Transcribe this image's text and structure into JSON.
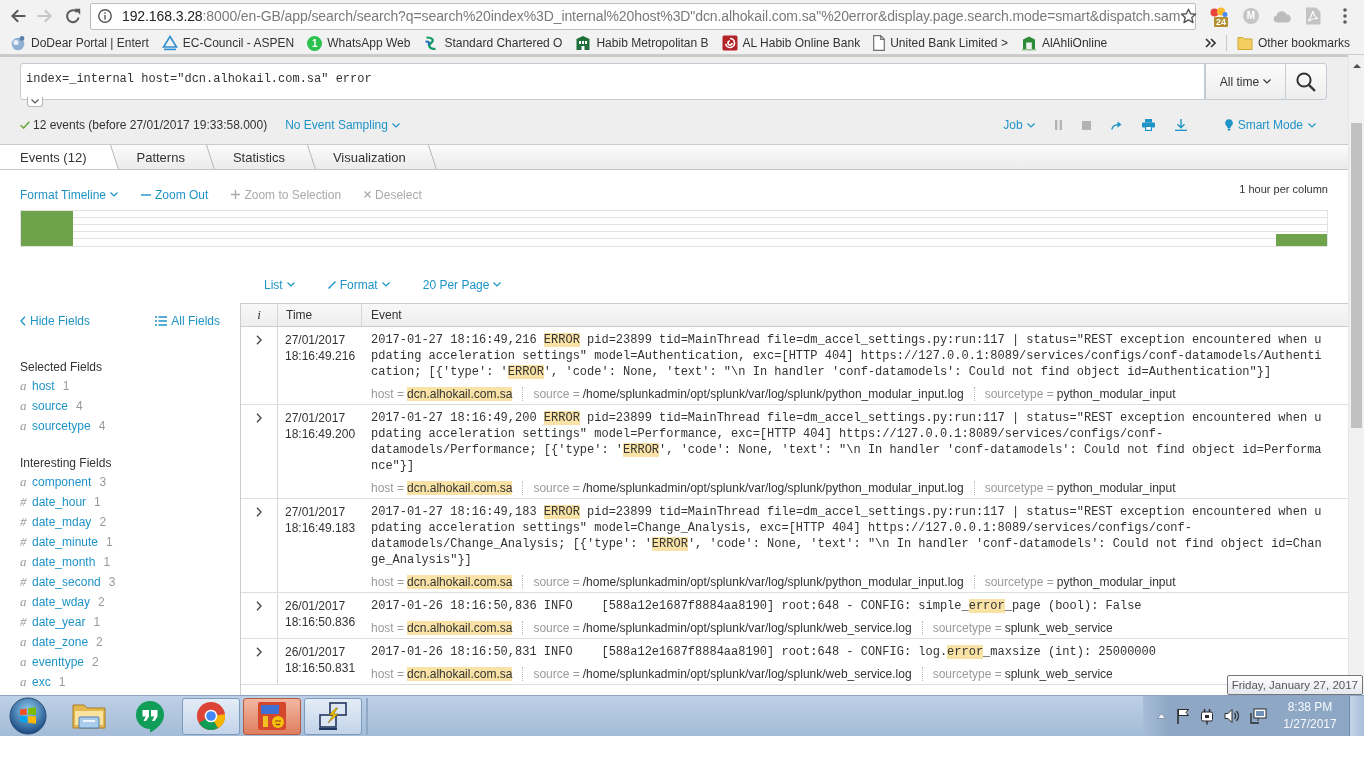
{
  "browser": {
    "url_host": "192.168.3.28",
    "url_rest": ":8000/en-GB/app/search/search?q=search%20index%3D_internal%20host%3D\"dcn.alhokail.com.sa\"%20error&display.page.search.mode=smart&dispatch.sam",
    "extensions": [
      {
        "kind": "dots",
        "badge": "24"
      },
      {
        "kind": "letter",
        "label": "M"
      },
      {
        "kind": "cloud"
      },
      {
        "kind": "pdf"
      }
    ],
    "bookmarks": [
      {
        "kind": "sphere",
        "label": "DoDear Portal | Entert"
      },
      {
        "kind": "triangle",
        "label": "EC-Council - ASPEN"
      },
      {
        "kind": "count",
        "badge": "1",
        "label": "WhatsApp Web"
      },
      {
        "kind": "stripes",
        "label": "Standard Chartered O"
      },
      {
        "kind": "building",
        "label": "Habib Metropolitan B"
      },
      {
        "kind": "tile",
        "label": "AL Habib Online Bank"
      },
      {
        "kind": "page",
        "label": "United Bank Limited >"
      },
      {
        "kind": "gate",
        "label": "AlAhliOnline"
      }
    ],
    "other_bookmarks": "Other bookmarks"
  },
  "search": {
    "query": "index=_internal host=\"dcn.alhokail.com.sa\" error",
    "expanded": false,
    "time_range": "All time"
  },
  "status": {
    "summary": "12 events (before 27/01/2017 19:33:58.000)",
    "sampling": "No Event Sampling",
    "job": "Job",
    "job_controls": [
      {
        "kind": "pause",
        "disabled": true
      },
      {
        "kind": "stop",
        "disabled": true
      },
      {
        "kind": "share",
        "disabled": false
      },
      {
        "kind": "print",
        "disabled": false
      },
      {
        "kind": "export",
        "disabled": false
      }
    ],
    "mode": "Smart Mode"
  },
  "tabs": [
    {
      "label": "Events (12)",
      "selected": true
    },
    {
      "label": "Patterns",
      "selected": false
    },
    {
      "label": "Statistics",
      "selected": false
    },
    {
      "label": "Visualization",
      "selected": false
    }
  ],
  "timeline": {
    "controls": [
      {
        "kind": "menu",
        "label": "Format Timeline",
        "disabled": false
      },
      {
        "kind": "zoom_out",
        "label": "Zoom Out",
        "disabled": false
      },
      {
        "kind": "zoom_in",
        "label": "Zoom to Selection",
        "disabled": true
      },
      {
        "kind": "deselect",
        "label": "Deselect",
        "disabled": true
      }
    ],
    "scale": "1 hour per column"
  },
  "results_toolbar": [
    {
      "kind": "list",
      "label": "List"
    },
    {
      "kind": "format",
      "label": "Format"
    },
    {
      "kind": "paging",
      "label": "20 Per Page"
    }
  ],
  "fields_sidebar": {
    "hide": "Hide Fields",
    "all": "All Fields",
    "groups": [
      {
        "title": "Selected Fields",
        "fields": [
          {
            "type": "a",
            "name": "host",
            "count": "1"
          },
          {
            "type": "a",
            "name": "source",
            "count": "4"
          },
          {
            "type": "a",
            "name": "sourcetype",
            "count": "4"
          }
        ]
      },
      {
        "title": "Interesting Fields",
        "fields": [
          {
            "type": "a",
            "name": "component",
            "count": "3"
          },
          {
            "type": "#",
            "name": "date_hour",
            "count": "1"
          },
          {
            "type": "#",
            "name": "date_mday",
            "count": "2"
          },
          {
            "type": "#",
            "name": "date_minute",
            "count": "1"
          },
          {
            "type": "a",
            "name": "date_month",
            "count": "1"
          },
          {
            "type": "#",
            "name": "date_second",
            "count": "3"
          },
          {
            "type": "a",
            "name": "date_wday",
            "count": "2"
          },
          {
            "type": "#",
            "name": "date_year",
            "count": "1"
          },
          {
            "type": "a",
            "name": "date_zone",
            "count": "2"
          },
          {
            "type": "a",
            "name": "eventtype",
            "count": "2"
          },
          {
            "type": "a",
            "name": "exc",
            "count": "1"
          }
        ]
      }
    ]
  },
  "events": {
    "columns": [
      "i",
      "Time",
      "Event"
    ],
    "rows": [
      {
        "time": "27/01/2017 18:16:49.216",
        "lines": [
          [
            {
              "text": "2017-01-27 18:16:49,216 ",
              "highlight": false
            },
            {
              "text": "ERROR",
              "highlight": true
            },
            {
              "text": " pid=23899 tid=MainThread file=dm_accel_settings.py:run:117 | status=\"REST exception encountered when u",
              "highlight": false
            }
          ],
          [
            {
              "text": "pdating acceleration settings\" model=Authentication, exc=[HTTP 404] https://127.0.0.1:8089/services/configs/conf-datamodels/Authenti",
              "highlight": false
            }
          ],
          [
            {
              "text": "cation; [{'type': '",
              "highlight": false
            },
            {
              "text": "ERROR",
              "highlight": true
            },
            {
              "text": "', 'code': None, 'text': \"\\n In handler 'conf-datamodels': Could not find object id=Authentication\"}]",
              "highlight": false
            }
          ]
        ],
        "fields": [
          {
            "label": "host =",
            "value": "dcn.alhokail.com.sa",
            "highlight": true
          },
          {
            "label": "source =",
            "value": "/home/splunkadmin/opt/splunk/var/log/splunk/python_modular_input.log",
            "highlight": false
          },
          {
            "label": "sourcetype =",
            "value": "python_modular_input",
            "highlight": false
          }
        ]
      },
      {
        "time": "27/01/2017 18:16:49.200",
        "lines": [
          [
            {
              "text": "2017-01-27 18:16:49,200 ",
              "highlight": false
            },
            {
              "text": "ERROR",
              "highlight": true
            },
            {
              "text": " pid=23899 tid=MainThread file=dm_accel_settings.py:run:117 | status=\"REST exception encountered when u",
              "highlight": false
            }
          ],
          [
            {
              "text": "pdating acceleration settings\" model=Performance, exc=[HTTP 404] https://127.0.0.1:8089/services/configs/conf-",
              "highlight": false
            }
          ],
          [
            {
              "text": "datamodels/Performance; [{'type': '",
              "highlight": false
            },
            {
              "text": "ERROR",
              "highlight": true
            },
            {
              "text": "', 'code': None, 'text': \"\\n In handler 'conf-datamodels': Could not find object id=Performa",
              "highlight": false
            }
          ],
          [
            {
              "text": "nce\"}]",
              "highlight": false
            }
          ]
        ],
        "fields": [
          {
            "label": "host =",
            "value": "dcn.alhokail.com.sa",
            "highlight": true
          },
          {
            "label": "source =",
            "value": "/home/splunkadmin/opt/splunk/var/log/splunk/python_modular_input.log",
            "highlight": false
          },
          {
            "label": "sourcetype =",
            "value": "python_modular_input",
            "highlight": false
          }
        ]
      },
      {
        "time": "27/01/2017 18:16:49.183",
        "lines": [
          [
            {
              "text": "2017-01-27 18:16:49,183 ",
              "highlight": false
            },
            {
              "text": "ERROR",
              "highlight": true
            },
            {
              "text": " pid=23899 tid=MainThread file=dm_accel_settings.py:run:117 | status=\"REST exception encountered when u",
              "highlight": false
            }
          ],
          [
            {
              "text": "pdating acceleration settings\" model=Change_Analysis, exc=[HTTP 404] https://127.0.0.1:8089/services/configs/conf-",
              "highlight": false
            }
          ],
          [
            {
              "text": "datamodels/Change_Analysis; [{'type': '",
              "highlight": false
            },
            {
              "text": "ERROR",
              "highlight": true
            },
            {
              "text": "', 'code': None, 'text': \"\\n In handler 'conf-datamodels': Could not find object id=Chan",
              "highlight": false
            }
          ],
          [
            {
              "text": "ge_Analysis\"}]",
              "highlight": false
            }
          ]
        ],
        "fields": [
          {
            "label": "host =",
            "value": "dcn.alhokail.com.sa",
            "highlight": true
          },
          {
            "label": "source =",
            "value": "/home/splunkadmin/opt/splunk/var/log/splunk/python_modular_input.log",
            "highlight": false
          },
          {
            "label": "sourcetype =",
            "value": "python_modular_input",
            "highlight": false
          }
        ]
      },
      {
        "time": "26/01/2017 18:16:50.836",
        "lines": [
          [
            {
              "text": "2017-01-26 18:16:50,836 INFO    [588a12e1687f8884aa8190] root:648 - CONFIG: simple_",
              "highlight": false
            },
            {
              "text": "error",
              "highlight": true
            },
            {
              "text": "_page (bool): False",
              "highlight": false
            }
          ]
        ],
        "fields": [
          {
            "label": "host =",
            "value": "dcn.alhokail.com.sa",
            "highlight": true
          },
          {
            "label": "source =",
            "value": "/home/splunkadmin/opt/splunk/var/log/splunk/web_service.log",
            "highlight": false
          },
          {
            "label": "sourcetype =",
            "value": "splunk_web_service",
            "highlight": false
          }
        ]
      },
      {
        "time": "26/01/2017 18:16:50.831",
        "lines": [
          [
            {
              "text": "2017-01-26 18:16:50,831 INFO    [588a12e1687f8884aa8190] root:648 - CONFIG: log.",
              "highlight": false
            },
            {
              "text": "error",
              "highlight": true
            },
            {
              "text": "_maxsize (int): 25000000",
              "highlight": false
            }
          ]
        ],
        "fields": [
          {
            "label": "host =",
            "value": "dcn.alhokail.com.sa",
            "highlight": true
          },
          {
            "label": "source =",
            "value": "/home/splunkadmin/opt/splunk/var/log/splunk/web_service.log",
            "highlight": false
          },
          {
            "label": "sourcetype =",
            "value": "splunk_web_service",
            "highlight": false
          }
        ]
      }
    ]
  },
  "taskbar": {
    "apps": [
      {
        "kind": "folder",
        "open": false,
        "alert": false
      },
      {
        "kind": "chat",
        "open": false,
        "alert": false
      },
      {
        "kind": "browser",
        "open": true,
        "alert": false
      },
      {
        "kind": "tile",
        "open": true,
        "alert": true
      },
      {
        "kind": "network",
        "open": true,
        "alert": false
      }
    ],
    "time": "8:38 PM",
    "date": "1/27/2017",
    "tooltip": "Friday, January 27, 2017"
  }
}
